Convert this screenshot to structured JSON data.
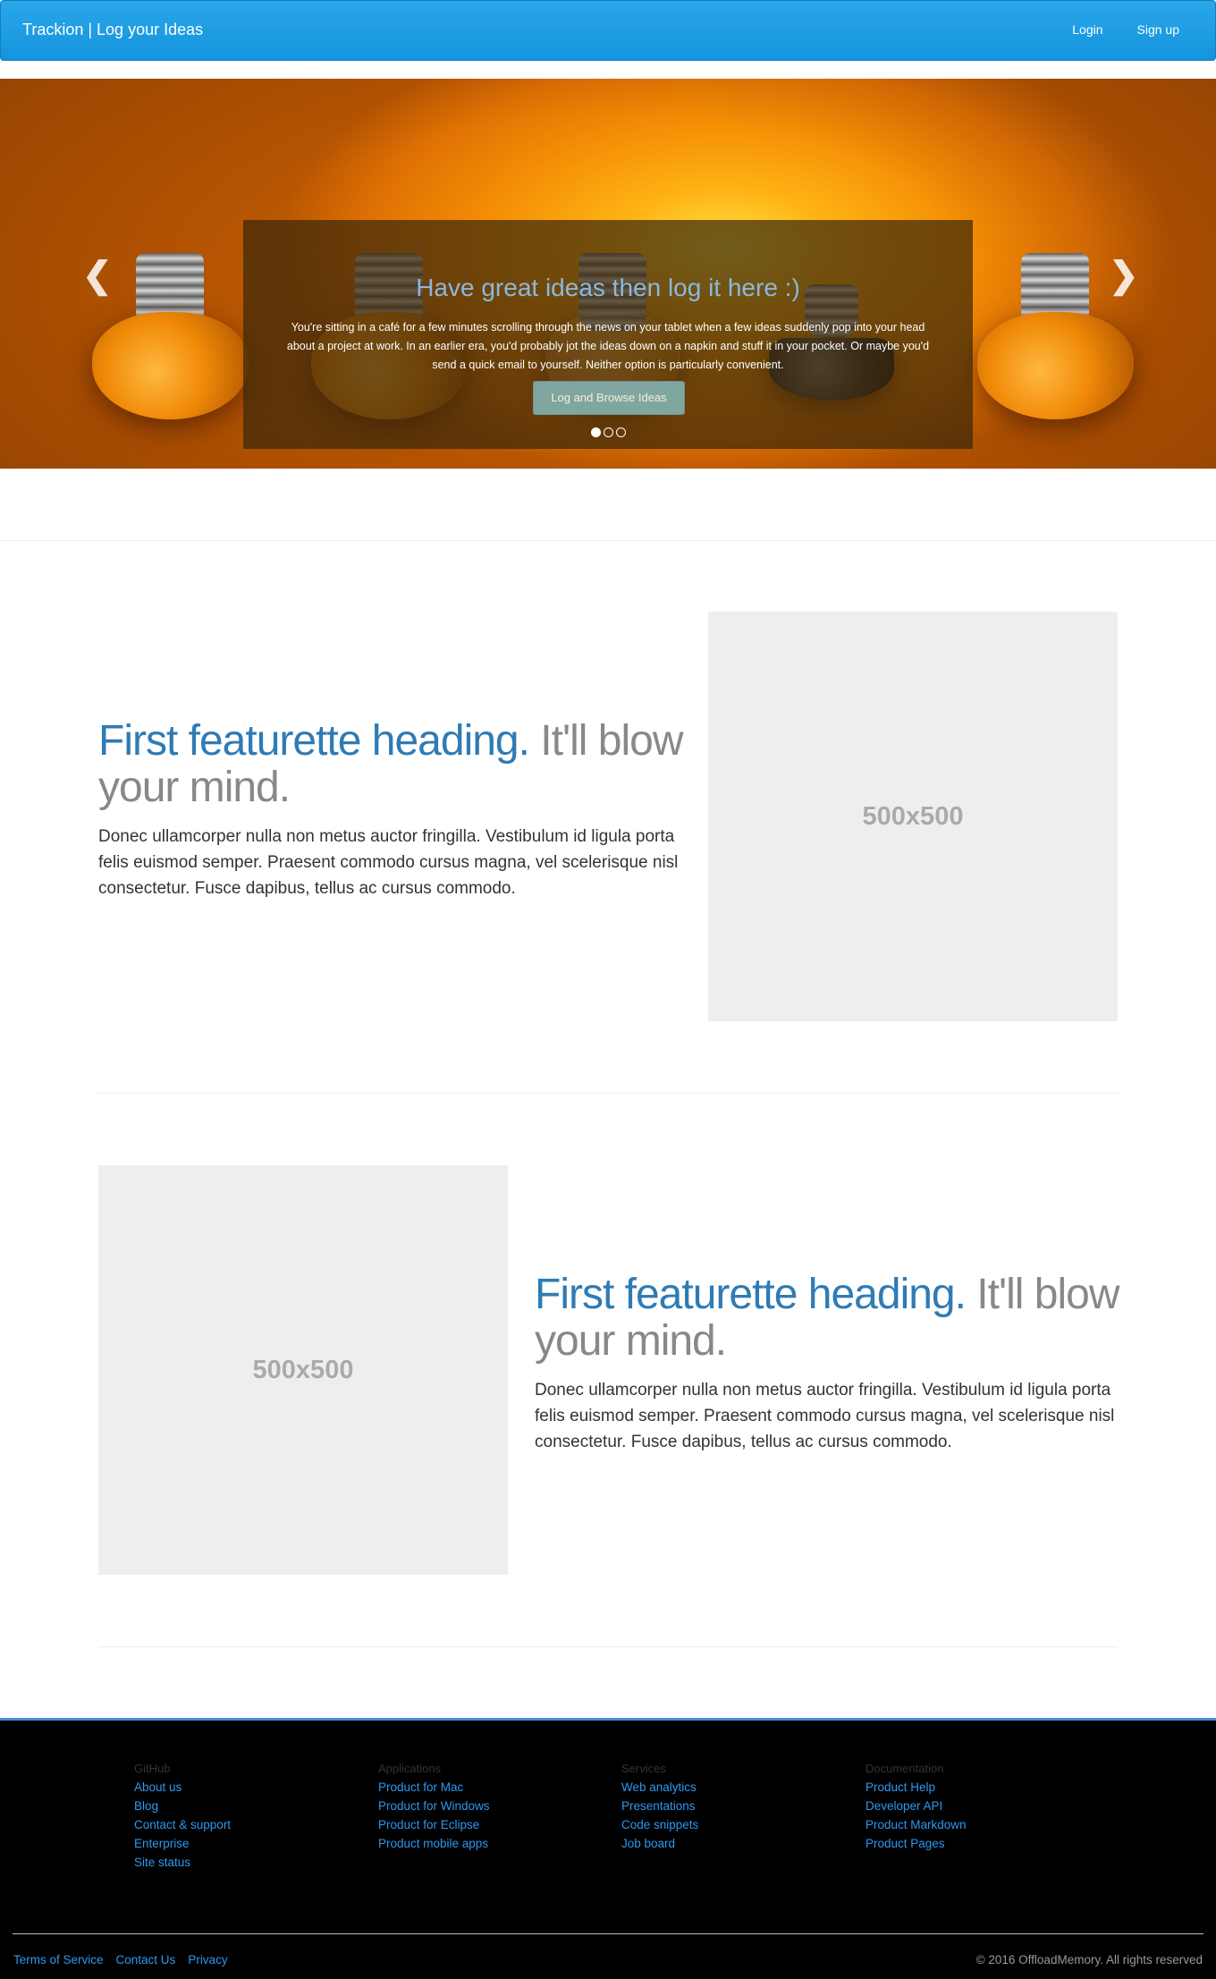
{
  "navbar": {
    "brand": "Trackion | Log your Ideas",
    "links": [
      "Login",
      "Sign up"
    ]
  },
  "hero": {
    "heading": "Have great ideas then log it here :)",
    "body": "You're sitting in a café for a few minutes scrolling through the news on your tablet when a few ideas suddenly pop into your head about a project at work. In an earlier era, you'd probably jot the ideas down on a napkin and stuff it in your pocket. Or maybe you'd send a quick email to yourself. Neither option is particularly convenient.",
    "cta_label": "Log and Browse Ideas",
    "prev_icon": "chevron-left-icon",
    "next_icon": "chevron-right-icon",
    "slides": 3,
    "active_slide": 1
  },
  "featurettes": [
    {
      "heading_accent": "First featurette heading.",
      "heading_muted": "It'll blow your mind.",
      "body": "Donec ullamcorper nulla non metus auctor fringilla. Vestibulum id ligula porta felis euismod semper. Praesent commodo cursus magna, vel scelerisque nisl consectetur. Fusce dapibus, tellus ac cursus commodo.",
      "image_label": "500x500"
    },
    {
      "heading_accent": "First featurette heading.",
      "heading_muted": "It'll blow your mind.",
      "body": "Donec ullamcorper nulla non metus auctor fringilla. Vestibulum id ligula porta felis euismod semper. Praesent commodo cursus magna, vel scelerisque nisl consectetur. Fusce dapibus, tellus ac cursus commodo.",
      "image_label": "500x500"
    }
  ],
  "footer": {
    "columns": [
      {
        "title": "GitHub",
        "links": [
          "About us",
          "Blog",
          "Contact & support",
          "Enterprise",
          "Site status"
        ]
      },
      {
        "title": "Applications",
        "links": [
          "Product for Mac",
          "Product for Windows",
          "Product for Eclipse",
          "Product mobile apps"
        ]
      },
      {
        "title": "Services",
        "links": [
          "Web analytics",
          "Presentations",
          "Code snippets",
          "Job board"
        ]
      },
      {
        "title": "Documentation",
        "links": [
          "Product Help",
          "Developer API",
          "Product Markdown",
          "Product Pages"
        ]
      }
    ],
    "bottom_links": [
      "Terms of Service",
      "Contact Us",
      "Privacy"
    ],
    "copyright": "© 2016 OffloadMemory. All rights reserved"
  },
  "colors": {
    "navbar": "#1a9be4",
    "accent_heading": "#2f7bb4",
    "footer_bg": "#000000",
    "footer_link": "#2e97ef",
    "footer_border": "#4b8ad8"
  }
}
